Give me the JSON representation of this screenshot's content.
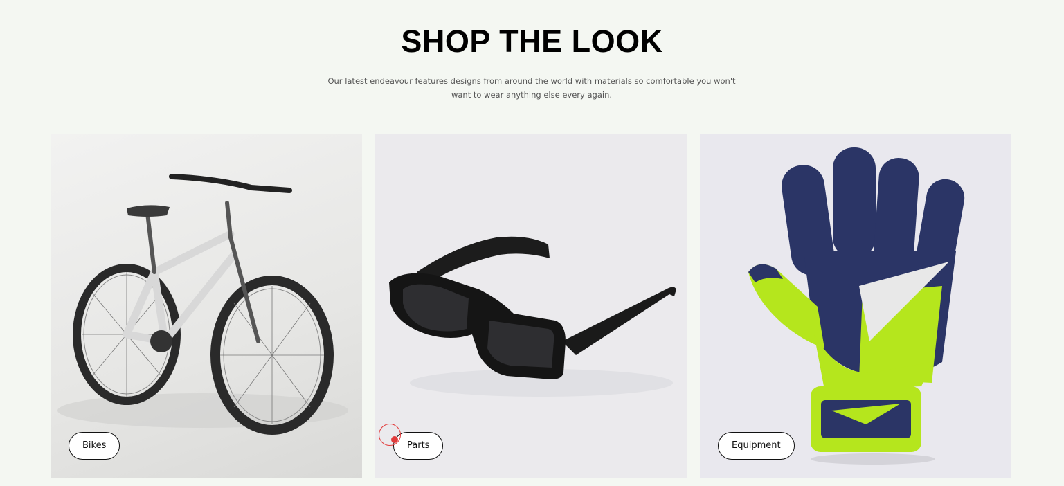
{
  "section": {
    "title": "SHOP THE LOOK",
    "description": "Our latest endeavour features designs from around the world with materials so comfortable you won't want to wear anything else every again."
  },
  "cards": [
    {
      "label": "Bikes",
      "image": "bicycle-image"
    },
    {
      "label": "Parts",
      "image": "sunglasses-image"
    },
    {
      "label": "Equipment",
      "image": "goalkeeper-glove-image"
    }
  ],
  "colors": {
    "background": "#f4f7f2",
    "title": "#000000",
    "cursor_accent": "#e23b3b",
    "glove_navy": "#2b3566",
    "glove_lime": "#b5e61d"
  }
}
